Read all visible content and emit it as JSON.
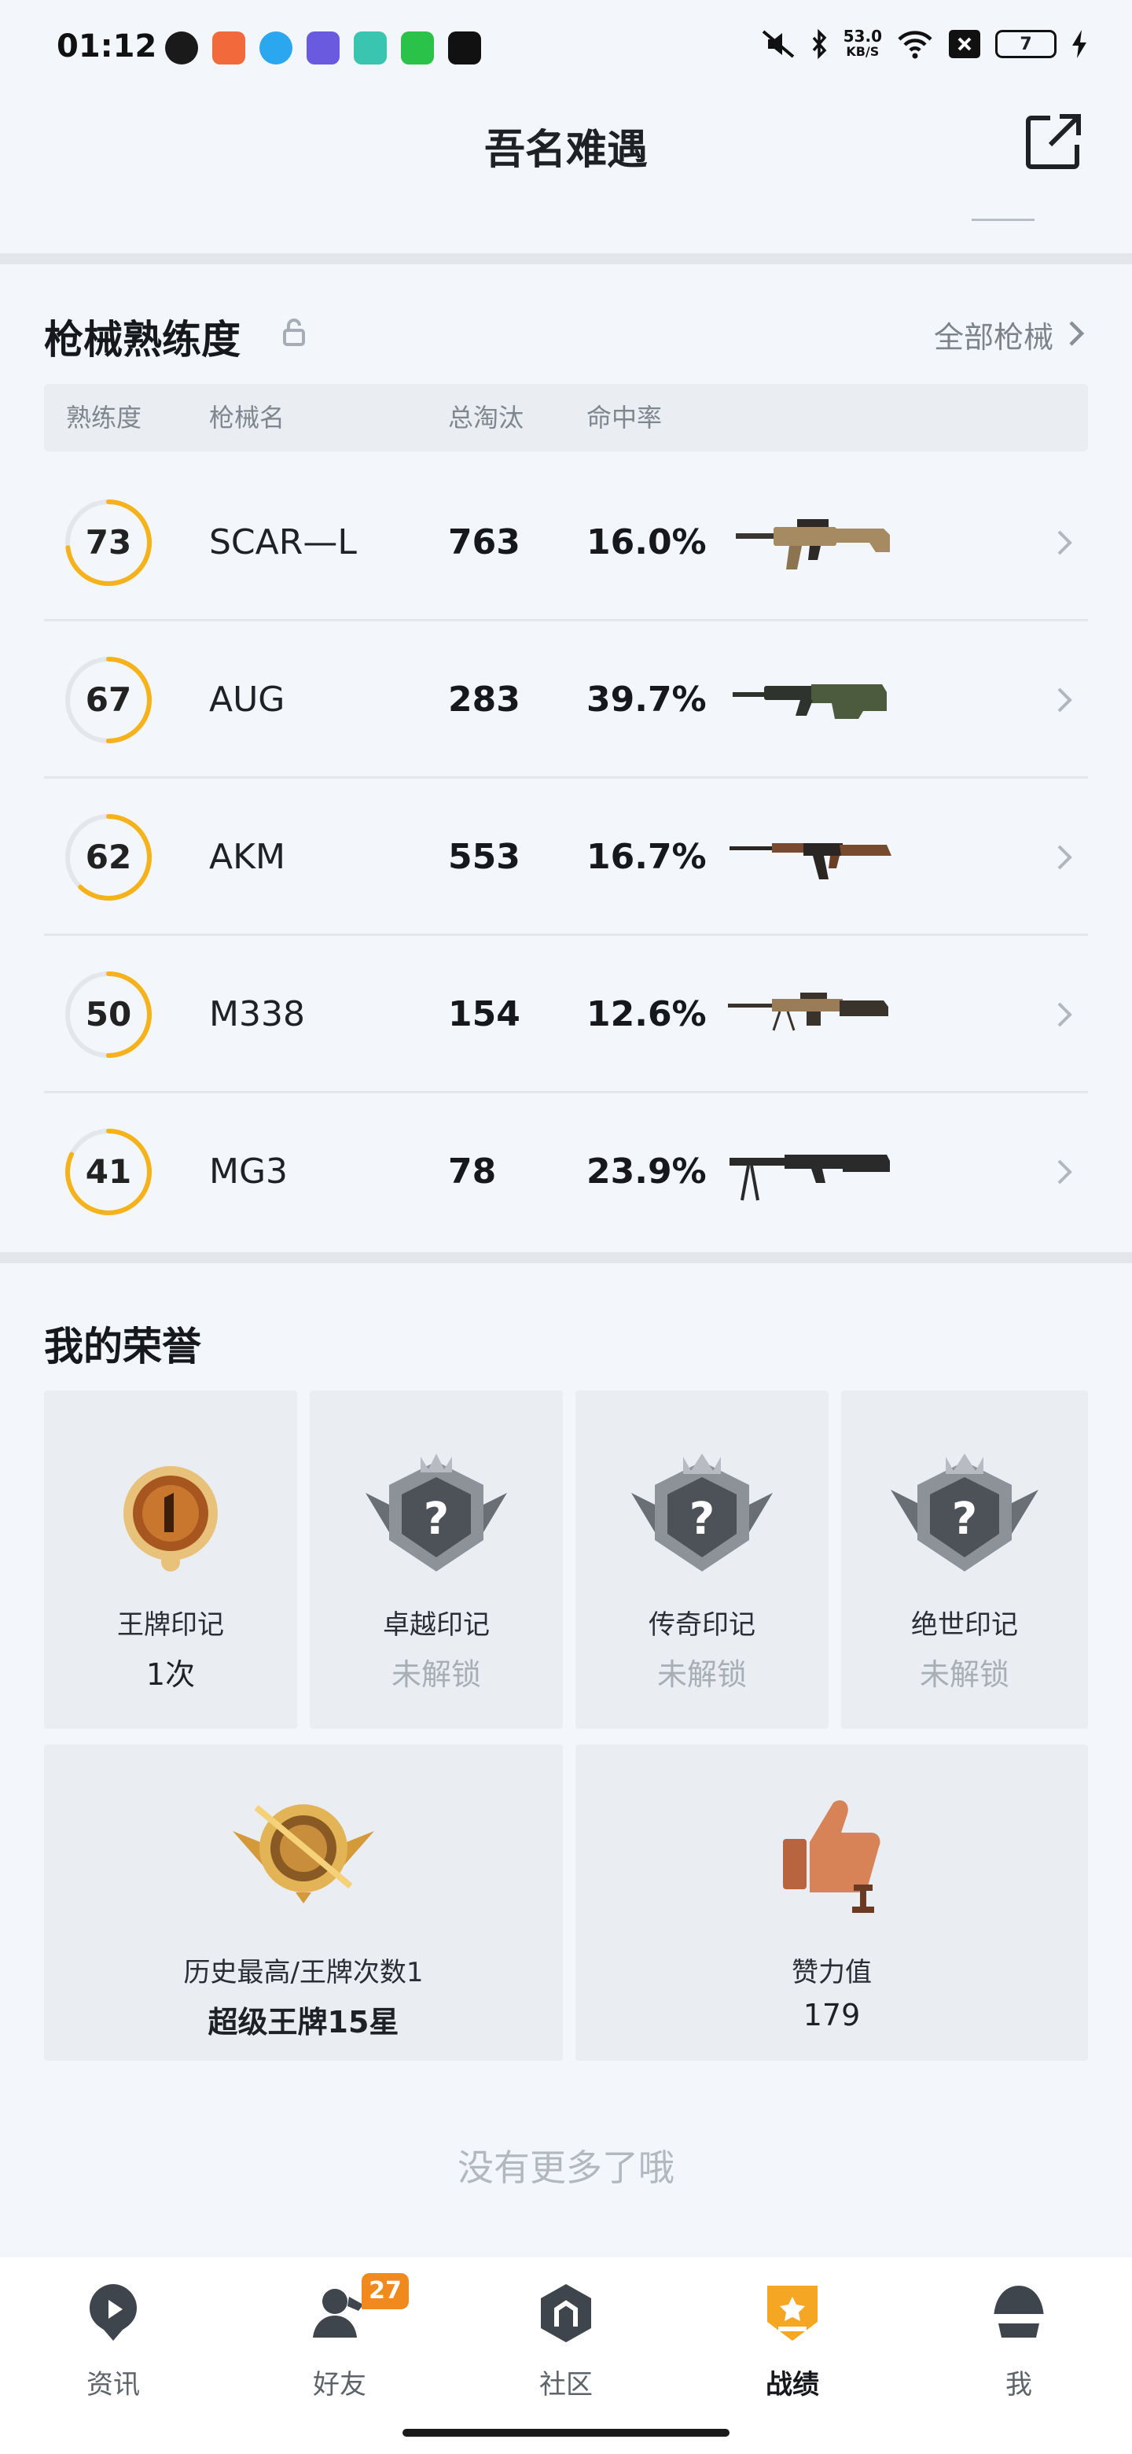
{
  "status_bar": {
    "time": "01:12",
    "net_speed": "53.0",
    "net_unit": "KB/S",
    "battery": "7",
    "app_icons": [
      "shield-app",
      "game-app",
      "qq-app",
      "anime-app",
      "message-app",
      "wechat-app",
      "douyin-app"
    ]
  },
  "header": {
    "title": "吾名难遇"
  },
  "weapons": {
    "title": "枪械熟练度",
    "all_label": "全部枪械",
    "columns": [
      "熟练度",
      "枪械名",
      "总淘汰",
      "命中率"
    ],
    "rows": [
      {
        "level": "73",
        "name": "SCAR—L",
        "kills": "763",
        "rate": "16.0%",
        "progress": 0.73
      },
      {
        "level": "67",
        "name": "AUG",
        "kills": "283",
        "rate": "39.7%",
        "progress": 0.5
      },
      {
        "level": "62",
        "name": "AKM",
        "kills": "553",
        "rate": "16.7%",
        "progress": 0.62
      },
      {
        "level": "50",
        "name": "M338",
        "kills": "154",
        "rate": "12.6%",
        "progress": 0.5
      },
      {
        "level": "41",
        "name": "MG3",
        "kills": "78",
        "rate": "23.9%",
        "progress": 0.82
      }
    ]
  },
  "honor": {
    "title": "我的荣誉",
    "cards": [
      {
        "label": "王牌印记",
        "value": "1次"
      },
      {
        "label": "卓越印记",
        "value": "未解锁"
      },
      {
        "label": "传奇印记",
        "value": "未解锁"
      },
      {
        "label": "绝世印记",
        "value": "未解锁"
      }
    ],
    "wide_cards": [
      {
        "label": "历史最高/王牌次数1",
        "value": "超级王牌15星"
      },
      {
        "label": "赞力值",
        "value": "179"
      }
    ]
  },
  "footer_text": "没有更多了哦",
  "nav": [
    {
      "label": "资讯"
    },
    {
      "label": "好友",
      "badge": "27"
    },
    {
      "label": "社区"
    },
    {
      "label": "战绩"
    },
    {
      "label": "我"
    }
  ],
  "colors": {
    "accent": "#f5b21b",
    "ring_track": "#e3e6ea"
  }
}
